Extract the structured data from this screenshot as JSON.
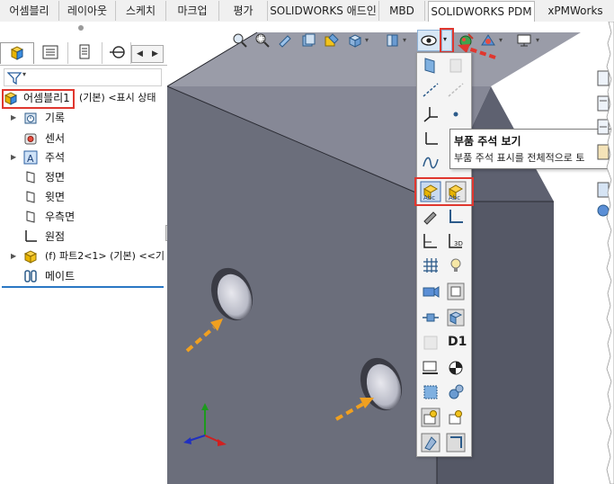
{
  "tabs": [
    {
      "label": "어셈블리"
    },
    {
      "label": "레이아웃"
    },
    {
      "label": "스케치"
    },
    {
      "label": "마크업"
    },
    {
      "label": "평가"
    },
    {
      "label": "SOLIDWORKS 애드인"
    },
    {
      "label": "MBD"
    },
    {
      "label": "SOLIDWORKS PDM"
    },
    {
      "label": "xPMWorks"
    }
  ],
  "tree": {
    "root": {
      "label": "어셈블리1",
      "suffix": "(기본) <표시 상태"
    },
    "items": [
      {
        "label": "기록"
      },
      {
        "label": "센서"
      },
      {
        "label": "주석"
      },
      {
        "label": "정면"
      },
      {
        "label": "윗면"
      },
      {
        "label": "우측면"
      },
      {
        "label": "원점"
      },
      {
        "label": "(f) 파트2<1> (기본) <<기"
      },
      {
        "label": "메이트"
      }
    ]
  },
  "tooltip": {
    "title": "부품 주석 보기",
    "description": "부품 주석 표시를 전체적으로 토"
  },
  "flyout": {
    "d1_label": "D1"
  },
  "colors": {
    "highlight_red": "#e0372f",
    "arrow_orange": "#f0a020",
    "selection_blue": "#2b78c4",
    "block_front": "#6b6e7b",
    "block_side": "#555866",
    "block_top": "#9a9ca8"
  },
  "icons": [
    "zoom-fit-icon",
    "zoom-area-icon",
    "previous-view-icon",
    "section-view-icon",
    "dynamic-annotation-icon",
    "view-orientation-icon",
    "display-style-icon",
    "hide-show-items-icon",
    "edit-appearance-icon",
    "apply-scene-icon",
    "view-settings-icon"
  ]
}
